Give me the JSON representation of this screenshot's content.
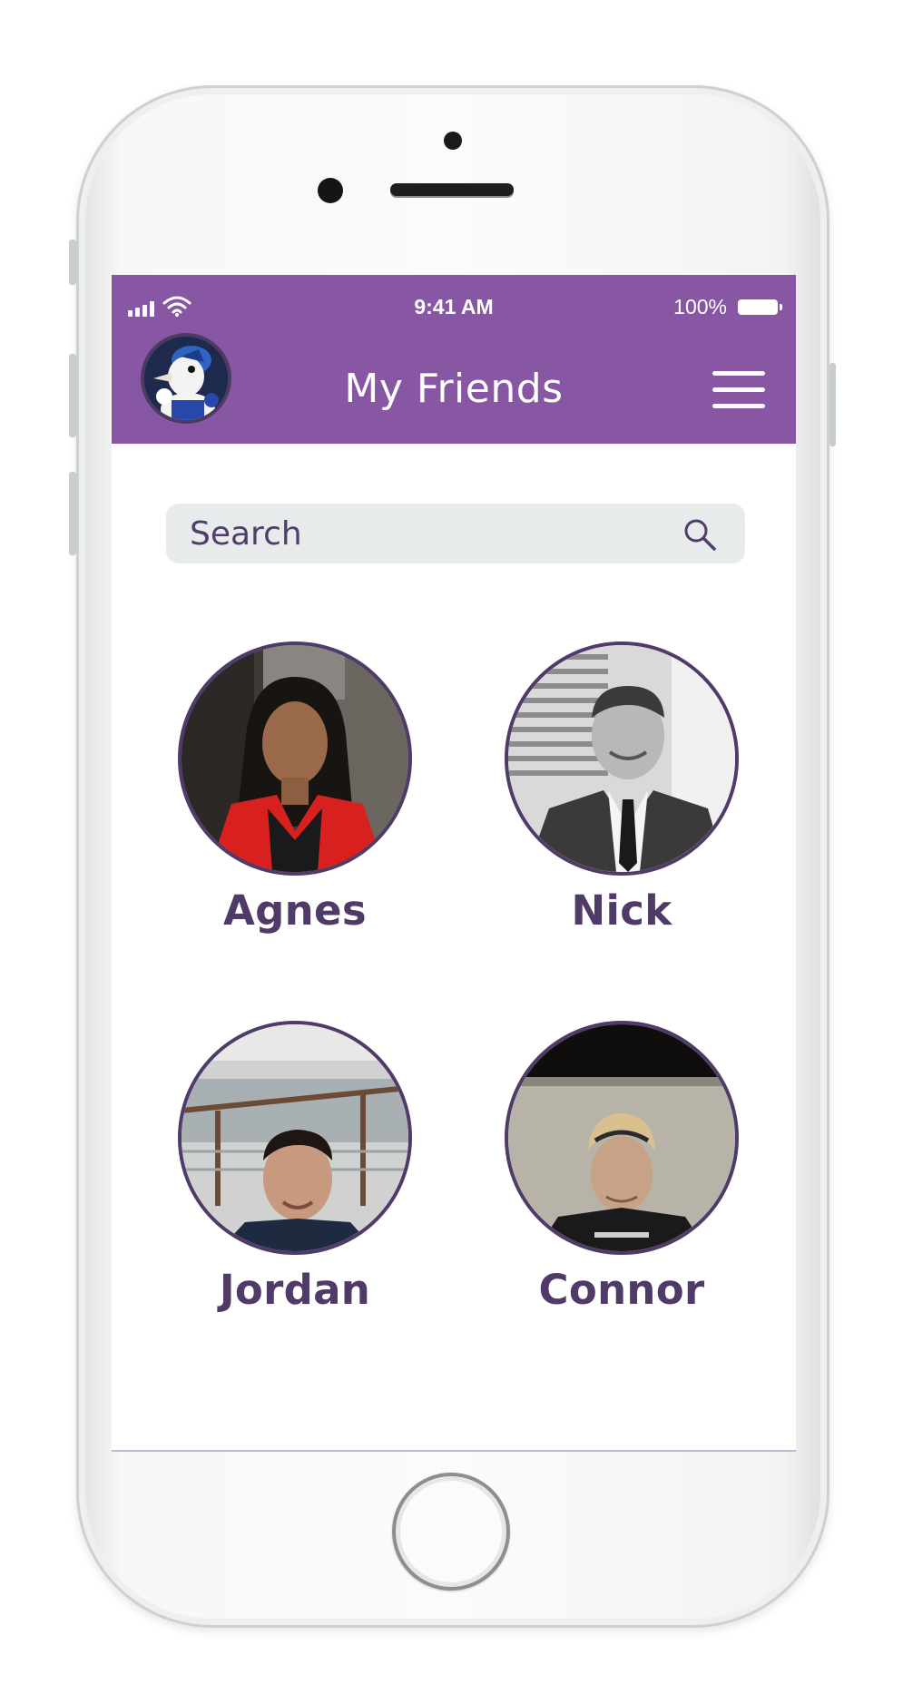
{
  "status_bar": {
    "time": "9:41 AM",
    "battery_percent": "100%"
  },
  "header": {
    "title": "My Friends",
    "avatar_icon": "bluejay-mascot-avatar",
    "menu_icon": "hamburger-menu-icon"
  },
  "search": {
    "placeholder": "Search",
    "value": "",
    "icon": "search-icon"
  },
  "friends": [
    {
      "name": "Agnes"
    },
    {
      "name": "Nick"
    },
    {
      "name": "Jordan"
    },
    {
      "name": "Connor"
    }
  ],
  "colors": {
    "header_bg": "#8757a4",
    "accent_text": "#4f3a68",
    "search_bg": "#e8ebeb"
  }
}
